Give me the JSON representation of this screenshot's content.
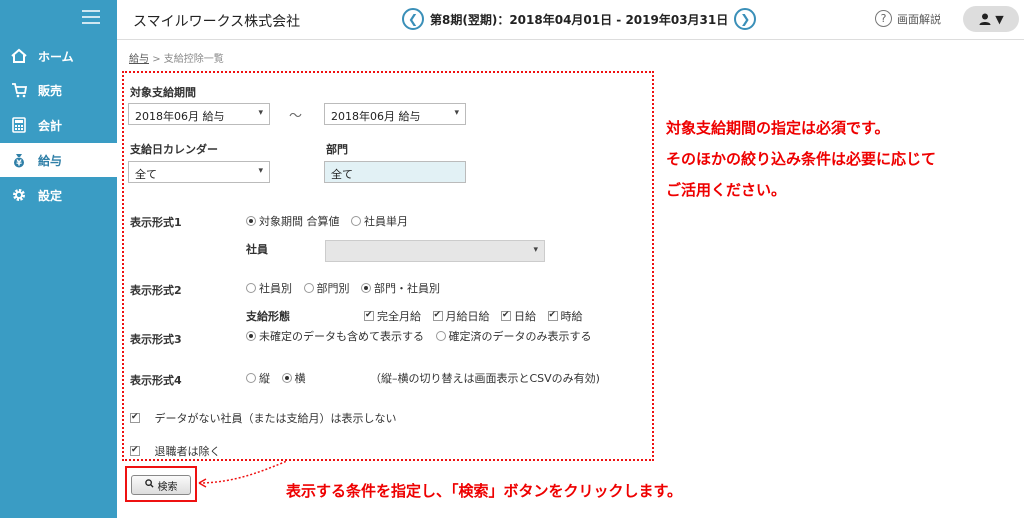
{
  "sidebar": {
    "items": [
      {
        "label": "ホーム",
        "icon": "home-icon"
      },
      {
        "label": "販売",
        "icon": "cart-icon"
      },
      {
        "label": "会計",
        "icon": "calculator-icon"
      },
      {
        "label": "給与",
        "icon": "money-bag-icon"
      },
      {
        "label": "設定",
        "icon": "gear-icon"
      }
    ]
  },
  "header": {
    "company": "スマイルワークス株式会社",
    "period": "第8期(翌期)：2018年04月01日 - 2019年03月31日",
    "help": "画面解説"
  },
  "breadcrumb": {
    "parent": "給与",
    "separator": ">",
    "current": "支給控除一覧"
  },
  "form": {
    "period_label": "対象支給期間",
    "period_from": "2018年06月 給与",
    "tilde": "～",
    "period_to": "2018年06月 給与",
    "calendar_label": "支給日カレンダー",
    "calendar_value": "全て",
    "dept_label": "部門",
    "dept_value": "全て",
    "display1_label": "表示形式1",
    "display1_opt1": "対象期間 合算値",
    "display1_opt2": "社員単月",
    "employee_label": "社員",
    "employee_value": "",
    "display2_label": "表示形式2",
    "display2_opt1": "社員別",
    "display2_opt2": "部門別",
    "display2_opt3": "部門・社員別",
    "paytype_label": "支給形態",
    "paytype_opt1": "完全月給",
    "paytype_opt2": "月給日給",
    "paytype_opt3": "日給",
    "paytype_opt4": "時給",
    "display3_label": "表示形式3",
    "display3_opt1": "未確定のデータも含めて表示する",
    "display3_opt2": "確定済のデータのみ表示する",
    "display4_label": "表示形式4",
    "display4_opt1": "縦",
    "display4_opt2": "横",
    "display4_note": "（縦–横の切り替えは画面表示とCSVのみ有効)",
    "hide_empty": "データがない社員（または支給月）は表示しない",
    "exclude_retired": "退職者は除く"
  },
  "search_button": "検索",
  "annotations": {
    "note1_line1": "対象支給期間の指定は必須です。",
    "note1_line2": "そのほかの絞り込み条件は必要に応じて",
    "note1_line3": "ご活用ください。",
    "note2": "表示する条件を指定し、「検索」ボタンをクリックします。"
  },
  "colors": {
    "sidebar": "#3a9cc4",
    "annotation": "#e11111",
    "accent": "#3a8fb8"
  }
}
